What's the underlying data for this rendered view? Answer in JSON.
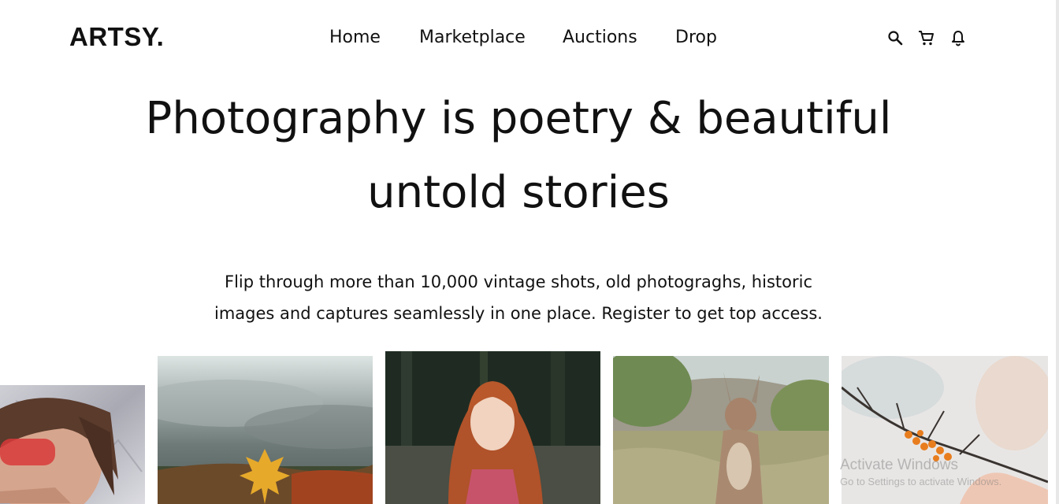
{
  "header": {
    "logo": "ARTSY.",
    "nav": [
      {
        "label": "Home"
      },
      {
        "label": "Marketplace"
      },
      {
        "label": "Auctions"
      },
      {
        "label": "Drop"
      }
    ],
    "icons": [
      "search-icon",
      "cart-icon",
      "bell-icon"
    ]
  },
  "hero": {
    "title_line1": "Photography is poetry & beautiful",
    "title_line2": "untold stories",
    "subtitle_line1": "Flip through more than 10,000 vintage shots, old photograghs, historic",
    "subtitle_line2": "images and captures seamlessly in one place. Register to get top access."
  },
  "gallery": {
    "photos": [
      {
        "subject": "person with red sunglasses and foil backdrop"
      },
      {
        "subject": "hand holding autumn maple leaf under cloudy sky"
      },
      {
        "subject": "red-haired girl in forest"
      },
      {
        "subject": "kangaroo in grassland"
      },
      {
        "subject": "sea buckthorn berries on branch"
      }
    ]
  },
  "watermark": {
    "title": "Activate Windows",
    "subtitle": "Go to Settings to activate Windows."
  },
  "colors": {
    "text": "#111111",
    "background": "#ffffff"
  }
}
